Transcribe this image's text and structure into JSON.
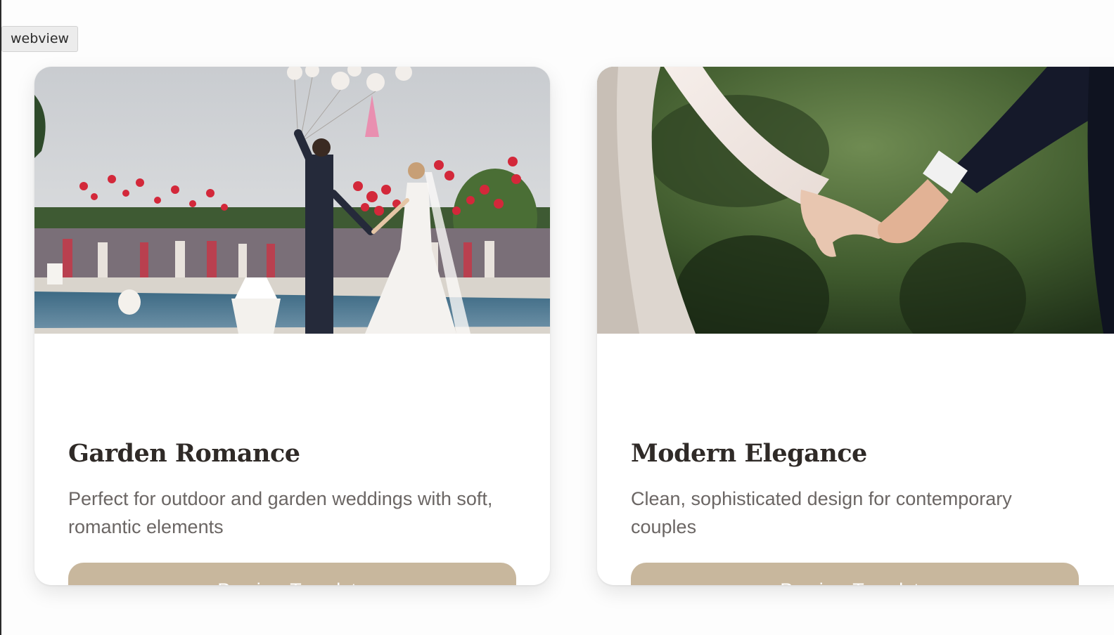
{
  "webview_label": "webview",
  "templates": [
    {
      "title": "Garden Romance",
      "description": "Perfect for outdoor and garden weddings with soft, romantic elements",
      "button_label": "Preview Template"
    },
    {
      "title": "Modern Elegance",
      "description": "Clean, sophisticated design for contemporary couples",
      "button_label": "Preview Template"
    }
  ],
  "colors": {
    "button": "#c8b79d",
    "title": "#2f2a27",
    "description": "#6b6664",
    "page_background": "#fdfdfd"
  }
}
